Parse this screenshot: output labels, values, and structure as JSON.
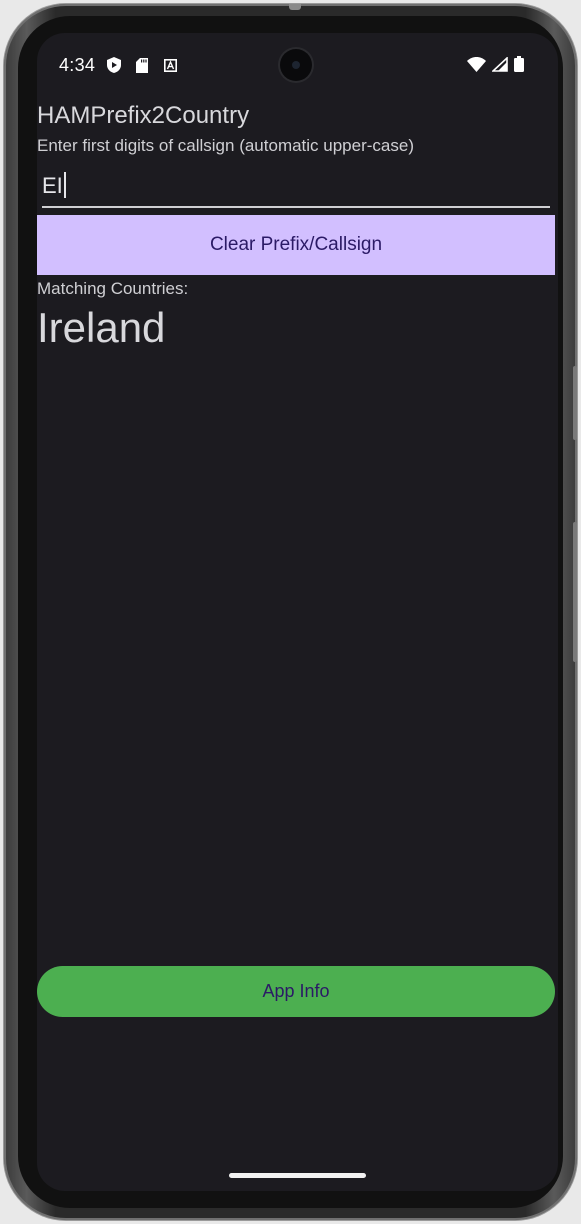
{
  "status_bar": {
    "time": "4:34",
    "left_icons": [
      "shield-play-icon",
      "sd-card-icon",
      "a-box-icon"
    ],
    "right_icons": [
      "wifi-icon",
      "cell-signal-icon",
      "battery-icon"
    ]
  },
  "app": {
    "title": "HAMPrefix2Country",
    "instruction": "Enter first digits of callsign (automatic upper-case)",
    "input_value": "EI",
    "clear_button_label": "Clear Prefix/Callsign",
    "matching_label": "Matching Countries:",
    "countries": [
      "Ireland"
    ],
    "app_info_label": "App Info"
  },
  "colors": {
    "background": "#1c1b20",
    "clear_button": "#d2bfff",
    "button_text": "#2b1a66",
    "app_info_button": "#4caf50"
  }
}
